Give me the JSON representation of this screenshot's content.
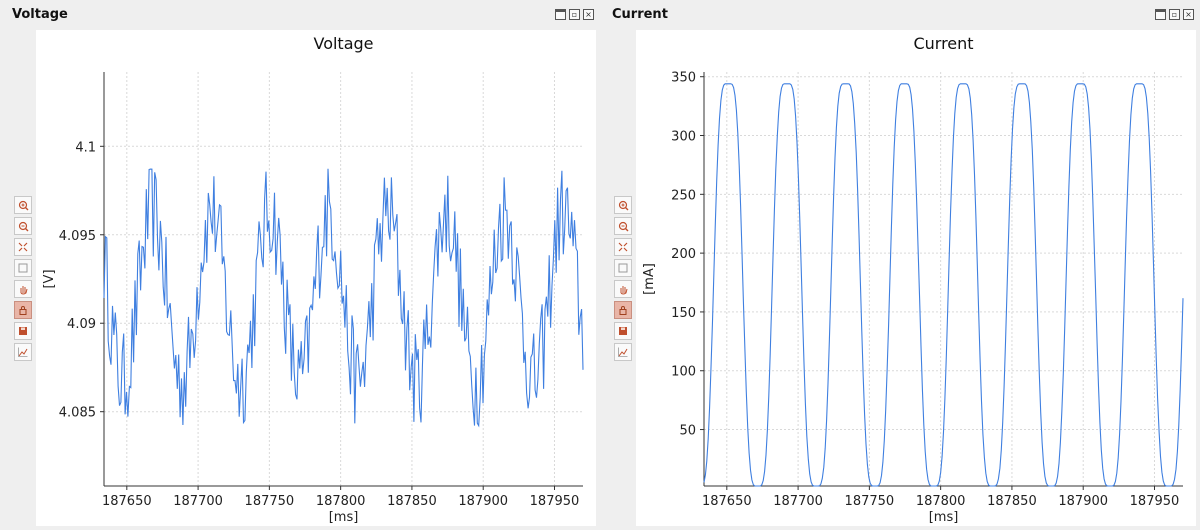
{
  "panels": [
    {
      "title": "Voltage",
      "window_buttons": [
        "maximize-icon",
        "float-icon",
        "close-icon"
      ],
      "toolbar_icons": [
        "zoom-in-icon",
        "zoom-out-icon",
        "zoom-fit-icon",
        "select-box-icon",
        "pan-hand-icon",
        "lock-icon",
        "save-icon",
        "line-chart-icon"
      ],
      "toolbar_active": "lock-icon"
    },
    {
      "title": "Current",
      "window_buttons": [
        "maximize-icon",
        "float-icon",
        "close-icon"
      ],
      "toolbar_icons": [
        "zoom-in-icon",
        "zoom-out-icon",
        "zoom-fit-icon",
        "select-box-icon",
        "pan-hand-icon",
        "lock-icon",
        "save-icon",
        "line-chart-icon"
      ],
      "toolbar_active": "lock-icon"
    }
  ],
  "colors": {
    "line": "#3f7fe0",
    "grid": "#d9d9d9",
    "background": "#efefef",
    "plot_bg": "#ffffff"
  },
  "chart_data": [
    {
      "type": "line",
      "title": "Voltage",
      "xlabel": "[ms]",
      "ylabel": "[V]",
      "xlim": [
        187634,
        187970
      ],
      "ylim": [
        4.0808,
        4.1042
      ],
      "xticks": [
        187650,
        187700,
        187750,
        187800,
        187850,
        187900,
        187950
      ],
      "xtick_labels": [
        "187650",
        "187700",
        "187750",
        "187800",
        "187850",
        "187900",
        "187950"
      ],
      "yticks": [
        4.085,
        4.09,
        4.095,
        4.1
      ],
      "ytick_labels": [
        "4.085",
        "4.09",
        "4.095",
        "4.1"
      ],
      "grid": true,
      "series": [
        {
          "values": {
            "period_ms": 41.2,
            "phase_ms": 187668,
            "mean": 4.0915,
            "amplitude": 0.0048,
            "noise": 0.0028,
            "max": 4.1015,
            "min": 4.0815,
            "samples": 340
          }
        }
      ]
    },
    {
      "type": "line",
      "title": "Current",
      "xlabel": "[ms]",
      "ylabel": "[mA]",
      "xlim": [
        187634,
        187970
      ],
      "ylim": [
        2,
        354
      ],
      "xticks": [
        187650,
        187700,
        187750,
        187800,
        187850,
        187900,
        187950
      ],
      "xtick_labels": [
        "187650",
        "187700",
        "187750",
        "187800",
        "187850",
        "187900",
        "187950"
      ],
      "yticks": [
        50,
        100,
        150,
        200,
        250,
        300,
        350
      ],
      "ytick_labels": [
        "50",
        "100",
        "150",
        "200",
        "250",
        "300",
        "350"
      ],
      "grid": true,
      "series": [
        {
          "values": {
            "period_ms": 41.2,
            "peak_ms": 187651,
            "max": 344,
            "min": 2,
            "plateau_ms": 6,
            "trough_ms": 4,
            "samples": 340
          }
        }
      ]
    }
  ]
}
